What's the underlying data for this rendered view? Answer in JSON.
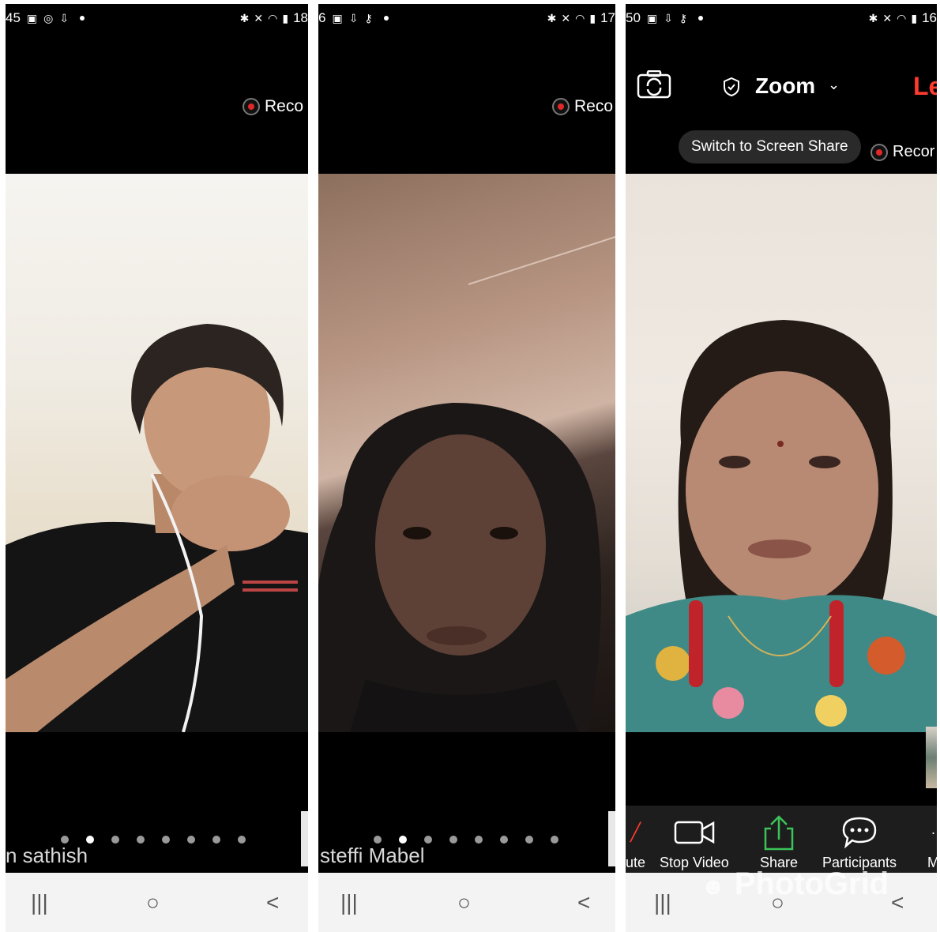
{
  "panels": [
    {
      "status_time": "45",
      "status_right": "18",
      "rec_label": "Reco",
      "participant_name": "n sathish",
      "nav": {
        "recents": "|||",
        "home": "○",
        "back": "<"
      }
    },
    {
      "status_time": "6",
      "status_right": "17",
      "rec_label": "Reco",
      "participant_name": "steffi Mabel",
      "nav": {
        "recents": "|||",
        "home": "○",
        "back": "<"
      }
    },
    {
      "status_time": "50",
      "status_right": "16",
      "rec_label": "Recor",
      "meeting_title": "Zoom",
      "leave_label": "Le",
      "switch_label": "Switch to Screen Share",
      "controls": {
        "mute": "ute",
        "stop_video": "Stop Video",
        "share": "Share",
        "participants": "Participants",
        "more": "M"
      },
      "watermark": "PhotoGrid",
      "nav": {
        "recents": "|||",
        "home": "○",
        "back": "<"
      }
    }
  ],
  "colors": {
    "record_red": "#e02828",
    "leave_red": "#ff3b30",
    "share_green": "#3cc35a",
    "black": "#000000",
    "navbar": "#f3f3f3"
  },
  "icons": [
    "camera-switch-icon",
    "shield-icon",
    "chevron-down-icon",
    "video-camera-icon",
    "share-arrow-icon",
    "chat-bubble-icon",
    "bluetooth-icon",
    "wifi-icon",
    "signal-icon"
  ]
}
